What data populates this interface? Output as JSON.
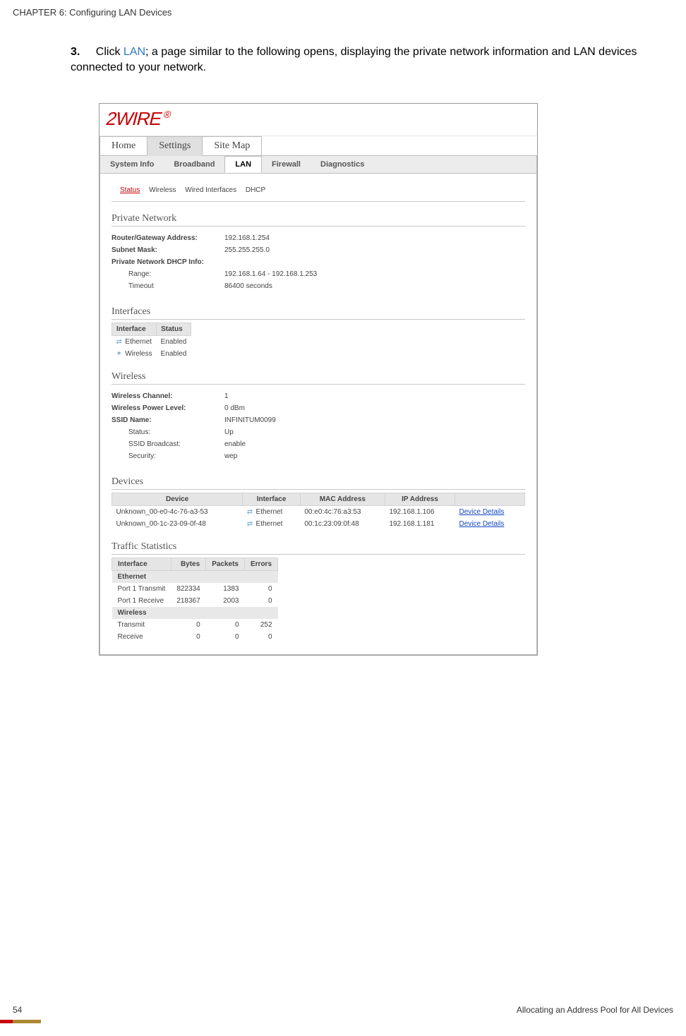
{
  "chapter_header": "CHAPTER 6: Configuring LAN Devices",
  "step": {
    "num": "3.",
    "pre": "Click ",
    "link": "LAN",
    "post": "; a page similar to the following opens, displaying the private network information and LAN devices connected to your network."
  },
  "logo": "2WIRE",
  "top_tabs": [
    "Home",
    "Settings",
    "Site Map"
  ],
  "sub_tabs": [
    "System Info",
    "Broadband",
    "LAN",
    "Firewall",
    "Diagnostics"
  ],
  "inner_nav": [
    "Status",
    "Wireless",
    "Wired Interfaces",
    "DHCP"
  ],
  "sections": {
    "private_network": "Private Network",
    "interfaces": "Interfaces",
    "wireless": "Wireless",
    "devices": "Devices",
    "traffic": "Traffic Statistics"
  },
  "private": [
    {
      "label": "Router/Gateway Address:",
      "value": "192.168.1.254",
      "bold": true
    },
    {
      "label": "Subnet Mask:",
      "value": "255.255.255.0",
      "bold": true
    },
    {
      "label": "Private Network DHCP Info:",
      "value": "",
      "bold": true
    },
    {
      "label": "Range:",
      "value": "192.168.1.64 - 192.168.1.253",
      "indent": true
    },
    {
      "label": "Timeout",
      "value": "86400   seconds",
      "indent": true
    }
  ],
  "iface_headers": [
    "Interface",
    "Status"
  ],
  "ifaces": [
    {
      "name": "Ethernet",
      "status": "Enabled"
    },
    {
      "name": "Wireless",
      "status": "Enabled"
    }
  ],
  "wireless_kv": [
    {
      "label": "Wireless Channel:",
      "value": "1",
      "bold": true
    },
    {
      "label": "Wireless Power Level:",
      "value": "0 dBm",
      "bold": true
    },
    {
      "label": "SSID Name:",
      "value": "INFINITUM0099",
      "bold": true
    },
    {
      "label": "Status:",
      "value": "Up",
      "indent": true
    },
    {
      "label": "SSID Broadcast:",
      "value": "enable",
      "indent": true
    },
    {
      "label": "Security:",
      "value": "wep",
      "indent": true
    }
  ],
  "dev_headers": [
    "Device",
    "Interface",
    "MAC Address",
    "IP Address",
    ""
  ],
  "devices": [
    {
      "name": "Unknown_00-e0-4c-76-a3-53",
      "iface": "Ethernet",
      "mac": "00:e0:4c:76:a3:53",
      "ip": "192.168.1.106",
      "link": "Device Details"
    },
    {
      "name": "Unknown_00-1c-23-09-0f-48",
      "iface": "Ethernet",
      "mac": "00:1c:23:09:0f:48",
      "ip": "192.168.1.181",
      "link": "Device Details"
    }
  ],
  "traf_headers": [
    "Interface",
    "Bytes",
    "Packets",
    "Errors"
  ],
  "traf_group1": "Ethernet",
  "traf_rows1": [
    {
      "iface": "Port 1 Transmit",
      "bytes": "822334",
      "packets": "1383",
      "errors": "0"
    },
    {
      "iface": "Port 1 Receive",
      "bytes": "218367",
      "packets": "2003",
      "errors": "0"
    }
  ],
  "traf_group2": "Wireless",
  "traf_rows2": [
    {
      "iface": "Transmit",
      "bytes": "0",
      "packets": "0",
      "errors": "252"
    },
    {
      "iface": "Receive",
      "bytes": "0",
      "packets": "0",
      "errors": "0"
    }
  ],
  "footer": {
    "page": "54",
    "title": "Allocating an Address Pool for All Devices"
  }
}
